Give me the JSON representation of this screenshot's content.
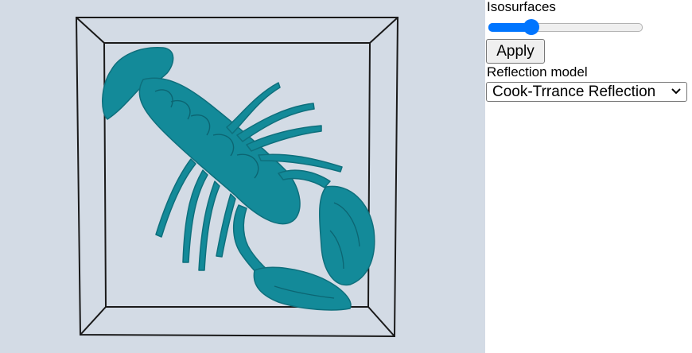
{
  "viewer": {
    "background_color": "#d3dbe5",
    "model_color": "#138a99",
    "frame_color": "#1a1a1a",
    "model_icon": "lobster-isosurface"
  },
  "controls": {
    "isosurfaces_label": "Isosurfaces",
    "isosurfaces_slider": {
      "min": 0,
      "max": 1,
      "value": 0.25,
      "accent_color": "#0075ff"
    },
    "apply_label": "Apply",
    "reflection_label": "Reflection model",
    "reflection_selected": "Cook-Trrance Reflection"
  }
}
